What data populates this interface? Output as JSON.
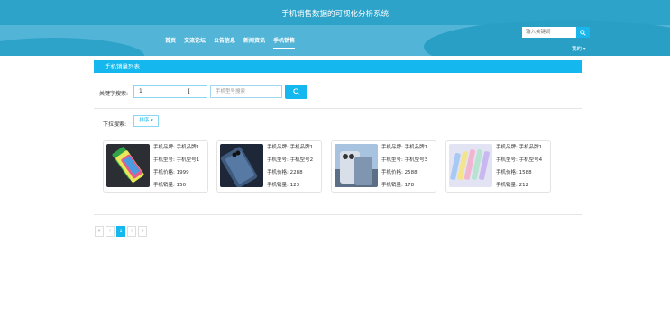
{
  "header": {
    "title": "手机销售数据的可视化分析系统",
    "nav": [
      "首页",
      "交流论坛",
      "公告信息",
      "新闻资讯",
      "手机销售"
    ],
    "active_nav": 4,
    "search_placeholder": "输入关键词",
    "user_menu": "我的 ▾"
  },
  "section": {
    "title": "手机销量列表"
  },
  "filters": {
    "keyword_label": "关键字搜索:",
    "keyword_value": "1",
    "model_placeholder": "手机型号搜索",
    "dropdown_label": "下拉搜索:",
    "sort_label": "排序 ▾"
  },
  "products": [
    {
      "brand": "手机品牌: 手机品牌1",
      "model": "手机型号: 手机型号1",
      "price": "手机价格: 1999",
      "sales": "手机销量: 150"
    },
    {
      "brand": "手机品牌: 手机品牌1",
      "model": "手机型号: 手机型号2",
      "price": "手机价格: 2288",
      "sales": "手机销量: 123"
    },
    {
      "brand": "手机品牌: 手机品牌1",
      "model": "手机型号: 手机型号3",
      "price": "手机价格: 2588",
      "sales": "手机销量: 178"
    },
    {
      "brand": "手机品牌: 手机品牌1",
      "model": "手机型号: 手机型号4",
      "price": "手机价格: 1588",
      "sales": "手机销量: 212"
    }
  ],
  "pagination": {
    "first": "«",
    "prev": "‹",
    "current": "1",
    "next": "›",
    "last": "»"
  },
  "colors": {
    "header": "#2ea3c9",
    "accent": "#15b8ee"
  }
}
